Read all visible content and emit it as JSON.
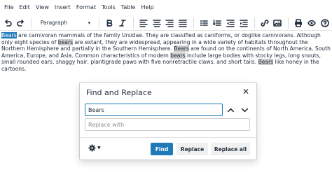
{
  "menubar": {
    "items": [
      "File",
      "Edit",
      "View",
      "Insert",
      "Format",
      "Tools",
      "Table",
      "Help"
    ]
  },
  "toolbar": {
    "format_select": "Paragraph",
    "icons": [
      "undo-icon",
      "redo-icon",
      "bold-icon",
      "italic-icon",
      "align-left-icon",
      "align-center-icon",
      "align-right-icon",
      "align-justify-icon",
      "bullet-list-icon",
      "numbered-list-icon",
      "outdent-icon",
      "indent-icon",
      "link-icon",
      "image-icon",
      "print-icon",
      "preview-icon",
      "help-icon"
    ]
  },
  "content": {
    "segments": [
      {
        "text": "Bears",
        "hl": "current"
      },
      {
        "text": " are carnivoran mammals of the family Ursidae. They are classified as caniforms, or doglike carnivorans. Although only eight species of "
      },
      {
        "text": "bears",
        "hl": "match"
      },
      {
        "text": " are extant, they are widespread, appearing in a wide variety of habitats throughout the Northern Hemisphere and partially in the Southern Hemisphere. "
      },
      {
        "text": "Bears",
        "hl": "match"
      },
      {
        "text": " are found on the continents of North America, South America, Europe, and Asia. Common characteristics of modern "
      },
      {
        "text": "bears",
        "hl": "match"
      },
      {
        "text": " include large bodies with stocky legs, long snouts, small rounded ears, shaggy hair, plantigrade paws with five nonretractile claws, and short tails. "
      },
      {
        "text": "Bears",
        "hl": "match"
      },
      {
        "text": " like honey in the cartoons."
      }
    ]
  },
  "dialog": {
    "title": "Find and Replace",
    "find_value": "Bears",
    "replace_placeholder": "Replace with",
    "buttons": {
      "find": "Find",
      "replace": "Replace",
      "replace_all": "Replace all"
    }
  },
  "colors": {
    "accent": "#207ab7",
    "text": "#222f3e",
    "match_highlight": "#cccccc"
  }
}
